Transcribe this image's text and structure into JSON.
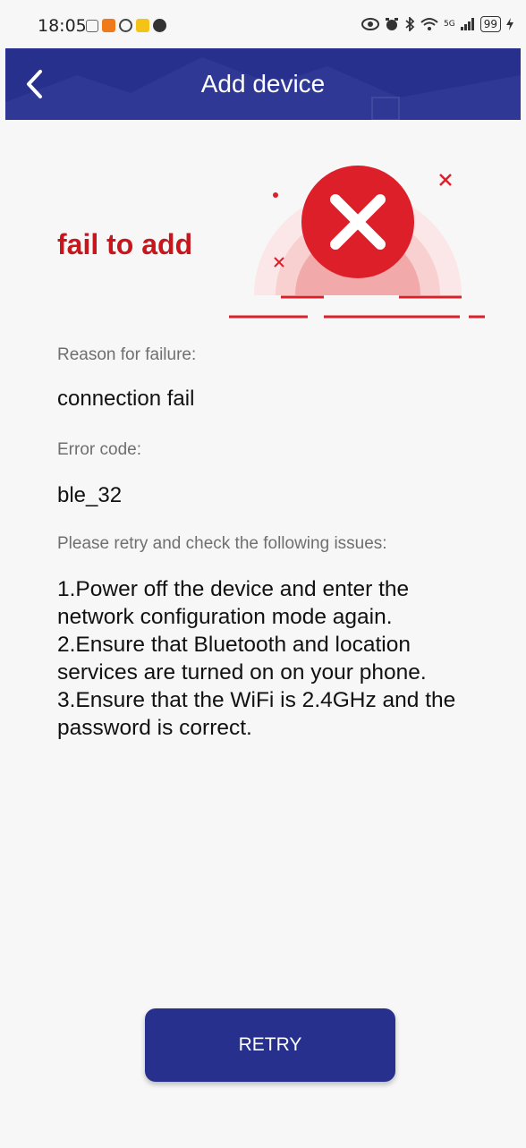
{
  "status_bar": {
    "time": "18:05",
    "network": "5G",
    "battery": "99"
  },
  "header": {
    "title": "Add device",
    "back_icon": "chevron-left-icon"
  },
  "result": {
    "title": "fail to add",
    "icon": "error-x-icon"
  },
  "failure": {
    "reason_label": "Reason for failure:",
    "reason_value": "connection fail",
    "code_label": "Error code:",
    "code_value": "ble_32"
  },
  "issues": {
    "intro": "Please retry and check the following issues:",
    "items": [
      "1.Power off the device and enter the network configuration mode again.",
      "2.Ensure that Bluetooth and location services are turned on on your phone.",
      "3.Ensure that the WiFi is 2.4GHz and the password is correct."
    ]
  },
  "actions": {
    "retry_label": "RETRY"
  },
  "colors": {
    "primary": "#27308c",
    "error": "#c8161d"
  }
}
